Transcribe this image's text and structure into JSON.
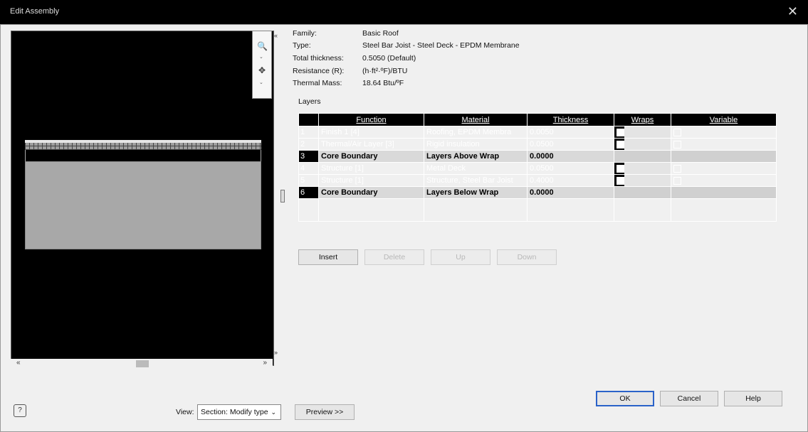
{
  "window": {
    "title": "Edit Assembly",
    "close_glyph": "✕"
  },
  "properties": [
    {
      "key": "Family:",
      "value": "Basic Roof"
    },
    {
      "key": "Type:",
      "value": "Steel Bar Joist - Steel Deck - EPDM Membrane"
    },
    {
      "key": "Total thickness:",
      "value": "0.5050 (Default)"
    },
    {
      "key": "Resistance (R):",
      "value": "(h·ft²·ºF)/BTU"
    },
    {
      "key": "Thermal Mass:",
      "value": "18.64 Btu/ºF"
    }
  ],
  "layers_label": "Layers",
  "table": {
    "headers": [
      "Function",
      "Material",
      "Thickness",
      "Wraps",
      "Variable"
    ],
    "rows": [
      {
        "num": "1",
        "function": "Finish 1 [4]",
        "material": "Roofing, EPDM Membra",
        "thickness": "0.0050",
        "core": false
      },
      {
        "num": "2",
        "function": "Thermal/Air Layer [3]",
        "material": "Rigid insulation",
        "thickness": "0.0500",
        "core": false
      },
      {
        "num": "3",
        "function": "Core Boundary",
        "material": "Layers Above Wrap",
        "thickness": "0.0000",
        "core": true
      },
      {
        "num": "4",
        "function": "Structure [1]",
        "material": "Metal Deck",
        "thickness": "0.0500",
        "core": false
      },
      {
        "num": "5",
        "function": "Structure [1]",
        "material": "Structure, Steel Bar Joist",
        "thickness": "0.4000",
        "core": false
      },
      {
        "num": "6",
        "function": "Core Boundary",
        "material": "Layers Below Wrap",
        "thickness": "0.0000",
        "core": true
      }
    ]
  },
  "buttons": {
    "insert": "Insert",
    "delete": "Delete",
    "up": "Up",
    "down": "Down",
    "ok": "OK",
    "cancel": "Cancel",
    "help": "Help"
  },
  "view": {
    "label": "View:",
    "selected": "Section: Modify type",
    "preview_button": "Preview >>"
  },
  "icons": {
    "zoom": "🔍",
    "pan": "✥",
    "help": "?",
    "chevron": "⌄",
    "collapse": "«",
    "left": "«",
    "right": "»",
    "resize": "»"
  }
}
